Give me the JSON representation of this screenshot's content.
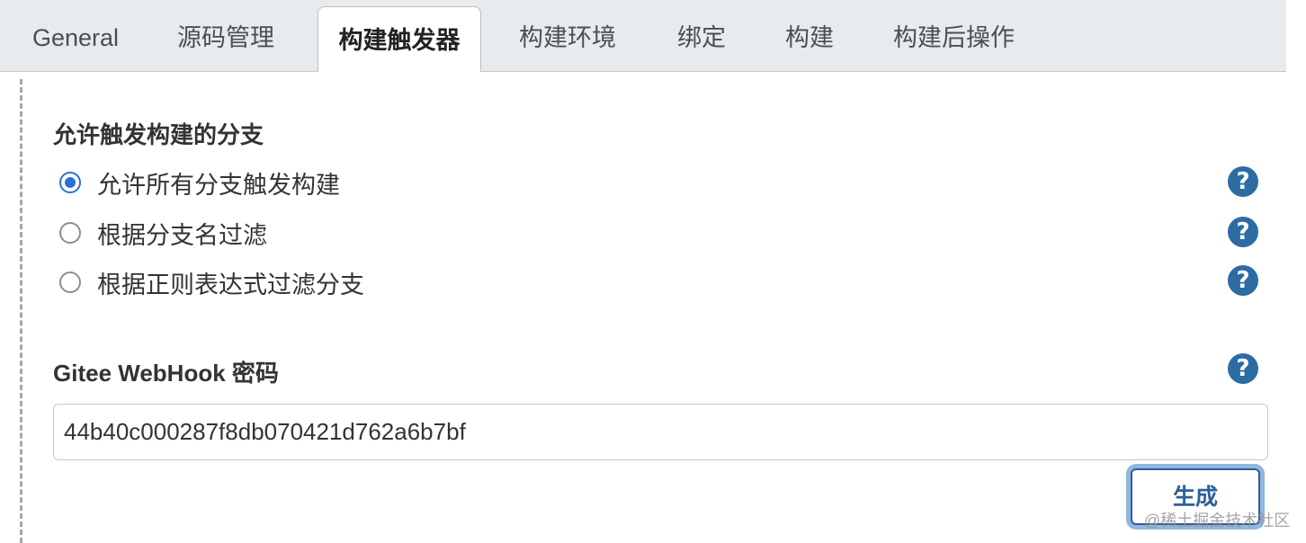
{
  "tabs": [
    {
      "label": "General"
    },
    {
      "label": "源码管理"
    },
    {
      "label": "构建触发器",
      "active": true
    },
    {
      "label": "构建环境"
    },
    {
      "label": "绑定"
    },
    {
      "label": "构建"
    },
    {
      "label": "构建后操作"
    }
  ],
  "branch_section": {
    "title": "允许触发构建的分支",
    "options": [
      {
        "label": "允许所有分支触发构建",
        "selected": true
      },
      {
        "label": "根据分支名过滤",
        "selected": false
      },
      {
        "label": "根据正则表达式过滤分支",
        "selected": false
      }
    ]
  },
  "webhook": {
    "label": "Gitee WebHook 密码",
    "value": "44b40c000287f8db070421d762a6b7bf",
    "generate_label": "生成"
  },
  "help_icon": "?",
  "watermark": "@稀土掘金技术社区",
  "colors": {
    "accent": "#2b6fd6",
    "help_bg": "#2d6ba3",
    "tabbar_bg": "#e8ebee"
  }
}
